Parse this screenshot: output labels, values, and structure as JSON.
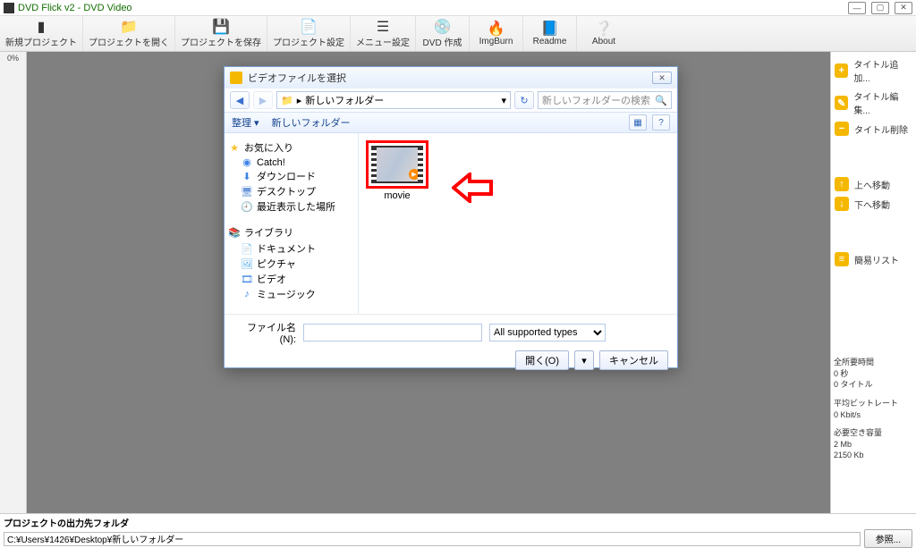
{
  "window": {
    "title": "DVD Flick v2 - DVD Video"
  },
  "toolbar": [
    {
      "label": "新規プロジェクト",
      "icon": "▮"
    },
    {
      "label": "プロジェクトを開く",
      "icon": "📁"
    },
    {
      "label": "プロジェクトを保存",
      "icon": "💾"
    },
    {
      "label": "プロジェクト設定",
      "icon": "📄"
    },
    {
      "label": "メニュー設定",
      "icon": "☰"
    },
    {
      "label": "DVD 作成",
      "icon": "💿"
    },
    {
      "label": "ImgBurn",
      "icon": "🔥"
    },
    {
      "label": "Readme",
      "icon": "📘"
    },
    {
      "label": "About",
      "icon": "❔"
    }
  ],
  "gutter": {
    "value": "0%"
  },
  "right_panel": {
    "buttons": [
      {
        "badge": "+",
        "label": "タイトル追加..."
      },
      {
        "badge": "✎",
        "label": "タイトル編集..."
      },
      {
        "badge": "−",
        "label": "タイトル削除"
      }
    ],
    "move": [
      {
        "badge": "↑",
        "label": "上へ移動"
      },
      {
        "badge": "↓",
        "label": "下へ移動"
      }
    ],
    "list_btn": {
      "badge": "≡",
      "label": "簡易リスト"
    },
    "stats": {
      "runtime_label": "全所要時間",
      "runtime_sec": "0 秒",
      "runtime_titles": "0 タイトル",
      "bitrate_label": "平均ビットレート",
      "bitrate_value": "0 Kbit/s",
      "space_label": "必要空き容量",
      "space_mb": "2 Mb",
      "space_kb": "2150 Kb"
    }
  },
  "bottom": {
    "label": "プロジェクトの出力先フォルダ",
    "path": "C:¥Users¥1426¥Desktop¥新しいフォルダー",
    "browse": "参照..."
  },
  "dialog": {
    "title": "ビデオファイルを選択",
    "path": "新しいフォルダー",
    "search_placeholder": "新しいフォルダーの検索",
    "toolbar": {
      "organize": "整理",
      "new_folder": "新しいフォルダー"
    },
    "tree": {
      "fav_header": "お気に入り",
      "fav_items": [
        "Catch!",
        "ダウンロード",
        "デスクトップ",
        "最近表示した場所"
      ],
      "lib_header": "ライブラリ",
      "lib_items": [
        "ドキュメント",
        "ピクチャ",
        "ビデオ",
        "ミュージック"
      ]
    },
    "file": {
      "name": "movie"
    },
    "filename_label": "ファイル名(N):",
    "filename_value": "",
    "filter": "All supported types",
    "open_btn": "開く(O)",
    "cancel_btn": "キャンセル"
  }
}
